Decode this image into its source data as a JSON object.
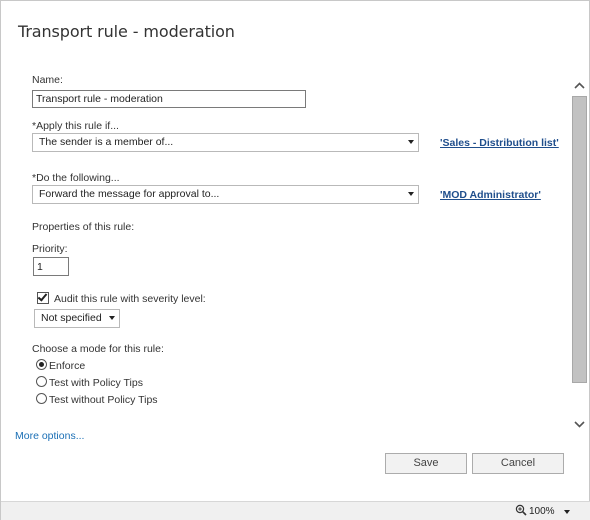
{
  "window": {
    "title": "Transport rule - moderation"
  },
  "form": {
    "name": {
      "label": "Name:",
      "value": "Transport rule - moderation"
    },
    "apply_if": {
      "label": "*Apply this rule if...",
      "selected": "The sender is a member of...",
      "link": "'Sales - Distribution list'"
    },
    "do_following": {
      "label": "*Do the following...",
      "selected": "Forward the message for approval to...",
      "link": "'MOD Administrator'"
    },
    "properties_label": "Properties of this rule:",
    "priority": {
      "label": "Priority:",
      "value": "1"
    },
    "audit": {
      "label": "Audit this rule with severity level:",
      "checked": true,
      "severity": "Not specified"
    },
    "mode": {
      "label": "Choose a mode for this rule:",
      "options": [
        {
          "label": "Enforce",
          "selected": true
        },
        {
          "label": "Test with Policy Tips",
          "selected": false
        },
        {
          "label": "Test without Policy Tips",
          "selected": false
        }
      ]
    }
  },
  "more_options": "More options...",
  "buttons": {
    "save": "Save",
    "cancel": "Cancel"
  },
  "status": {
    "zoom": "100%"
  }
}
